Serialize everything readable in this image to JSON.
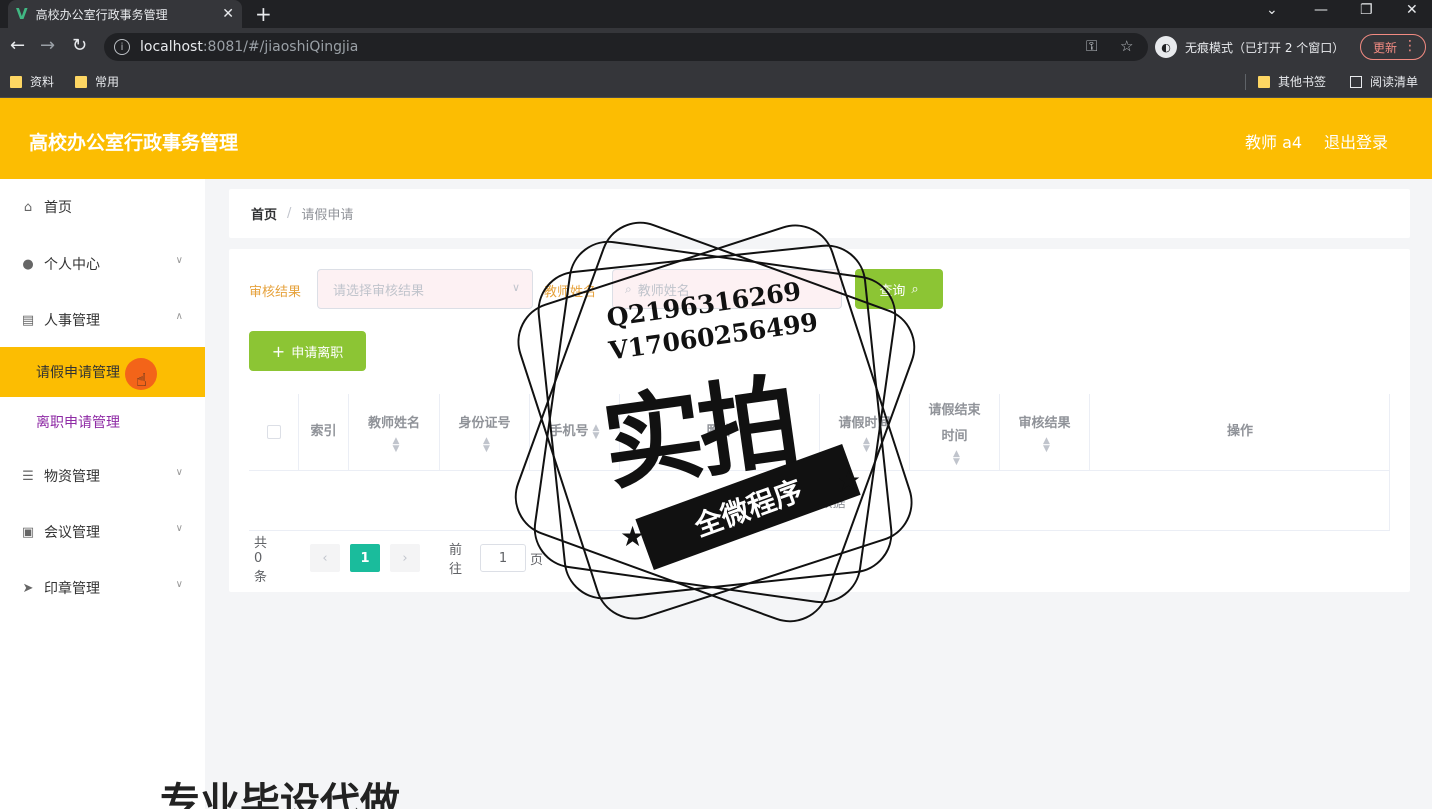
{
  "browser": {
    "tab_title": "高校办公室行政事务管理",
    "tab_close": "✕",
    "new_tab": "+",
    "url_host": "localhost",
    "url_path": ":8081/#/jiaoshiQingjia",
    "incognito_label": "无痕模式（已打开 2 个窗口）",
    "update_label": "更新",
    "bookmarks": [
      "资料",
      "常用"
    ],
    "bookmarks_right": [
      "其他书签",
      "阅读清单"
    ]
  },
  "header": {
    "title": "高校办公室行政事务管理",
    "user": "教师 a4",
    "logout": "退出登录"
  },
  "sidebar": {
    "items": [
      {
        "label": "首页",
        "icon": "home-icon"
      },
      {
        "label": "个人中心",
        "icon": "user-icon"
      },
      {
        "label": "人事管理",
        "icon": "clipboard-icon"
      },
      {
        "label": "物资管理",
        "icon": "list-icon"
      },
      {
        "label": "会议管理",
        "icon": "calendar-icon"
      },
      {
        "label": "印章管理",
        "icon": "send-icon"
      }
    ],
    "subitems": [
      {
        "label": "请假申请管理"
      },
      {
        "label": "离职申请管理"
      }
    ]
  },
  "breadcrumb": {
    "home": "首页",
    "separator": "/",
    "current": "请假申请"
  },
  "search": {
    "result_label": "审核结果",
    "result_placeholder": "请选择审核结果",
    "name_label": "教师姓名",
    "name_placeholder": "教师姓名",
    "query_button": "查询"
  },
  "actions": {
    "apply_button": "申请离职"
  },
  "table": {
    "columns": [
      "索引",
      "教师姓名",
      "身份证号",
      "手机号",
      "照片",
      "请假时间",
      "请假结束时间",
      "审核结果",
      "操作"
    ],
    "empty_text": "暂无数据",
    "rows": []
  },
  "pagination": {
    "total": "共 0 条",
    "current_page": "1",
    "goto_label": "前往",
    "goto_value": "1",
    "page_suffix": "页"
  },
  "watermark": {
    "line1": "Q2196316269",
    "line2": "V17060256499",
    "big": "实拍",
    "ribbon": "全微程序",
    "bottom": "专业毕设代做"
  },
  "colors": {
    "header": "#fcbd02",
    "green_button": "#8cc534",
    "active_page": "#1abc9c",
    "active_menu": "#fcbd02"
  }
}
